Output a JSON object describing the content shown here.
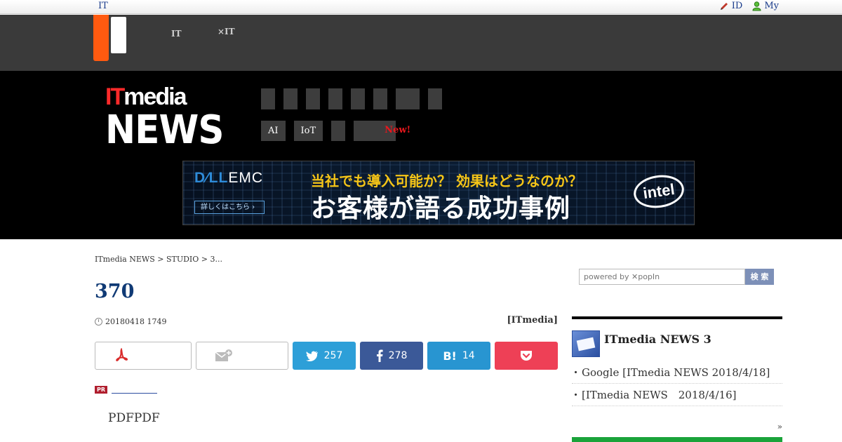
{
  "util_bar": {
    "left_text": "IT",
    "id_label": "ID",
    "my_label": "My"
  },
  "global_nav": [
    {
      "line1": "　　",
      "line2": "IT"
    },
    {
      "line1": "　　　",
      "line2": "×IT"
    }
  ],
  "header": {
    "logo_it": "IT",
    "logo_media": "media",
    "logo_news": "NEWS",
    "tags": [
      "AI",
      "IoT"
    ],
    "new_label": "New!"
  },
  "banner": {
    "brand_dell": "D∕LL",
    "brand_emc": "EMC",
    "detail_btn": "詳しくはこちら ›",
    "copy_line1": "当社でも導入可能か？ 効果はどうなのか？",
    "copy_line2": "お客様が語る成功事例",
    "partner": "intel"
  },
  "breadcrumb": "ITmedia NEWS > STUDIO > 3...",
  "article": {
    "title": "370",
    "date": "20180418 1749",
    "author": "[ITmedia]",
    "pdf_text": "PDFPDF"
  },
  "share": {
    "twitter_count": "257",
    "facebook_count": "278",
    "hatena_count": "14"
  },
  "pr_badge": "PR",
  "search": {
    "placeholder": "powered by ✕popIn",
    "button": "検 索"
  },
  "sidebar": {
    "title": "ITmedia NEWS 3",
    "items": [
      "Google [ITmedia NEWS 2018/4/18]",
      "[ITmedia NEWS　2018/4/16]"
    ],
    "more": "»"
  }
}
